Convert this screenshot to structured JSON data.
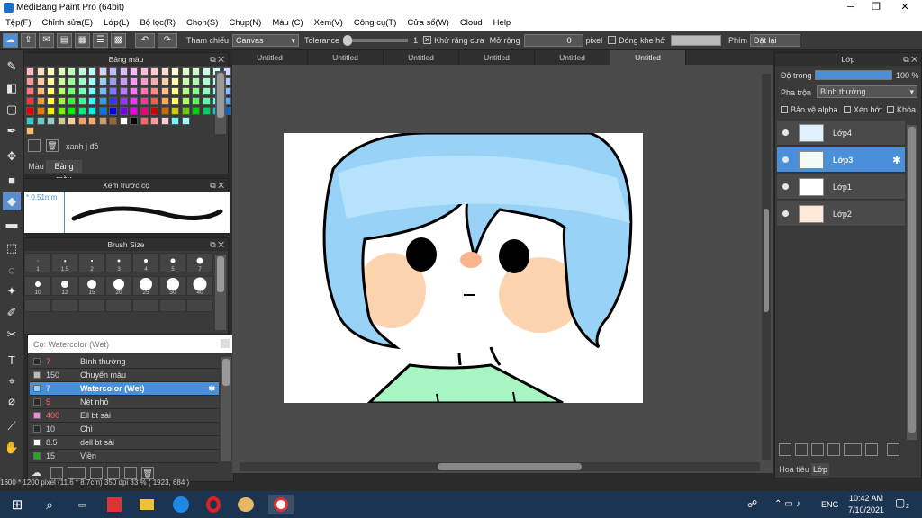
{
  "window": {
    "title": "MediBang Paint Pro (64bit)",
    "minimize": "─",
    "maximize": "❐",
    "close": "✕"
  },
  "menu": [
    "Tệp(F)",
    "Chỉnh sửa(E)",
    "Lớp(L)",
    "Bộ lọc(R)",
    "Chọn(S)",
    "Chụp(N)",
    "Màu (C)",
    "Xem(V)",
    "Công cụ(T)",
    "Cửa sổ(W)",
    "Cloud",
    "Help"
  ],
  "toolbar": {
    "ref_label": "Tham chiếu",
    "ref_value": "Canvas",
    "tolerance_label": "Tolerance",
    "tolerance_value": "1",
    "antialias_label": "Khử răng cưa",
    "expand_label": "Mở rộng",
    "expand_value": "0",
    "expand_unit": "pixel",
    "gap_label": "Đóng khe hở",
    "key_label": "Phím",
    "reset_label": "Đặt lại"
  },
  "palette": {
    "title": "Bảng màu",
    "color_name": "xanh j đỏ",
    "tab_color": "Màu",
    "tab_palette": "Bảng màu"
  },
  "preview": {
    "title": "Xem trước cọ",
    "size": "0.51mm"
  },
  "brush_size": {
    "title": "Brush Size",
    "labels": [
      "1",
      "1.5",
      "2",
      "3",
      "4",
      "5",
      "7",
      "10",
      "12",
      "15",
      "20",
      "25",
      "30",
      "40"
    ]
  },
  "brush_list": {
    "title": "Cọ: Watercolor (Wet)",
    "items": [
      {
        "size": "7",
        "name": "Bình thường",
        "color": "#2a2a2a"
      },
      {
        "size": "150",
        "name": "Chuyển màu",
        "color": "#bbbbbb"
      },
      {
        "size": "7",
        "name": "Watercolor (Wet)",
        "color": "#8fd0ff"
      },
      {
        "size": "5",
        "name": "Nét nhỏ",
        "color": "#2a2a2a"
      },
      {
        "size": "400",
        "name": "Ell bt sài",
        "color": "#f08ad0"
      },
      {
        "size": "10",
        "name": "Chì",
        "color": "#2a2a2a"
      },
      {
        "size": "8.5",
        "name": "dell bt sài",
        "color": "#ffffff"
      },
      {
        "size": "15",
        "name": "Viền",
        "color": "#22aa22"
      }
    ]
  },
  "tabs": [
    "Untitled",
    "Untitled",
    "Untitled",
    "Untitled",
    "Untitled",
    "Untitled"
  ],
  "layers": {
    "title": "Lớp",
    "opacity_label": "Độ trong",
    "opacity_value": "100 %",
    "opacity": 1.0,
    "blend_label": "Pha trộn",
    "blend_value": "Bình thường",
    "protect_alpha": "Bảo vệ alpha",
    "clipping": "Xén bớt",
    "lock": "Khóa",
    "items": [
      "Lớp4",
      "Lớp3",
      "Lớp1",
      "Lớp2"
    ],
    "tab_nav": "Hoa tiêu",
    "tab_layer": "Lớp"
  },
  "status": "1600 * 1200 pixel  (11.6 * 8.7cm)  350 dpi  33 %  ( 1923, 684 )",
  "taskbar": {
    "lang": "ENG",
    "time": "10:42 AM",
    "date": "7/10/2021",
    "notif": "2"
  },
  "colors": {
    "accent": "#4a90d9",
    "hair": "#99d2f7",
    "shirt": "#a6f5c3",
    "blush": "#fdd4b0"
  }
}
